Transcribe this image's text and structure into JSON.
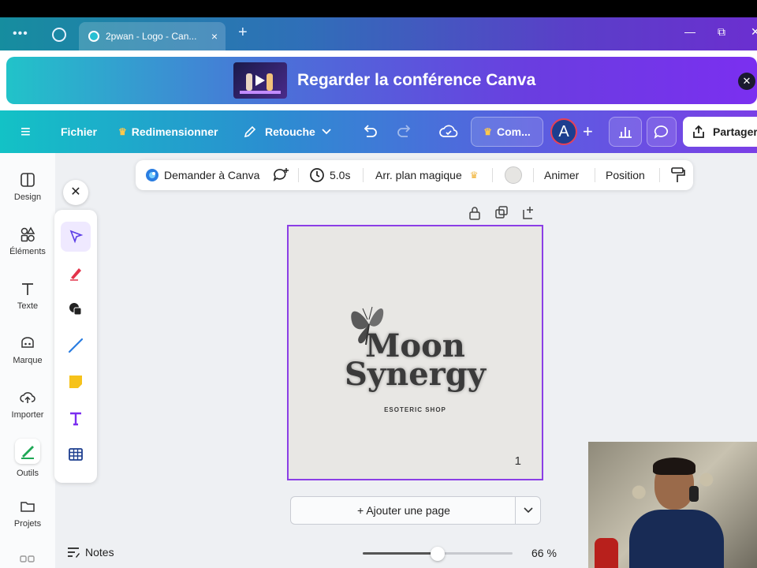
{
  "browser": {
    "tab_title": "2pwan - Logo - Can...",
    "tab_close": "×",
    "new_tab": "+",
    "menu_dots": "•••",
    "window_controls": {
      "minimize": "—",
      "restore": "⧉",
      "close": "✕"
    }
  },
  "banner": {
    "text": "Regarder la conférence Canva",
    "close": "✕"
  },
  "toolbar": {
    "menu_icon": "≡",
    "file": "Fichier",
    "resize": "Redimensionner",
    "edit": "Retouche",
    "collaborate": "Com...",
    "avatar_initial": "A",
    "add": "+",
    "share": "Partager"
  },
  "context_toolbar": {
    "ask_canva": "Demander à Canva",
    "duration": "5.0s",
    "magic_bg": "Arr. plan magique",
    "animate": "Animer",
    "position": "Position"
  },
  "sidebar": {
    "items": [
      {
        "label": "Design",
        "icon": "design-icon"
      },
      {
        "label": "Éléments",
        "icon": "elements-icon"
      },
      {
        "label": "Texte",
        "icon": "text-icon"
      },
      {
        "label": "Marque",
        "icon": "brand-icon"
      },
      {
        "label": "Importer",
        "icon": "upload-icon"
      },
      {
        "label": "Outils",
        "icon": "tools-icon"
      },
      {
        "label": "Projets",
        "icon": "folder-icon"
      }
    ]
  },
  "draw_panel": {
    "close": "✕",
    "tools": [
      "select-pointer",
      "pen",
      "shapes",
      "line",
      "sticky-note",
      "text",
      "table"
    ]
  },
  "canvas": {
    "logo_line1": "Moon",
    "logo_line2": "Synergy",
    "logo_sub": "ESOTERIC SHOP",
    "page_number": "1"
  },
  "add_page": {
    "label": "+ Ajouter une page",
    "chevron": "⌄"
  },
  "bottom": {
    "notes": "Notes",
    "zoom_label": "66 %",
    "zoom_level": 0.5
  },
  "colors": {
    "accent": "#8b3ee6",
    "banner_start": "#21c3c9",
    "banner_end": "#7b2ff0",
    "avatar_bg": "#1d3e8f",
    "avatar_ring": "#e84055"
  }
}
